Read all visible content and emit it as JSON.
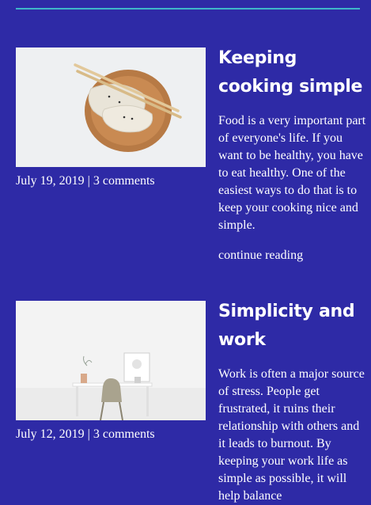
{
  "posts": [
    {
      "title": "Keeping cooking simple",
      "date": "July 19, 2019",
      "separator": "|",
      "comments": "3 comments",
      "excerpt": "Food is a very important part of everyone's life. If you want to be healthy, you have to eat healthy. One of the easiest ways to do that is to keep your cooking nice and simple.",
      "more": "continue reading",
      "image_icon": "dumplings-photo"
    },
    {
      "title": "Simplicity and work",
      "date": "July 12, 2019",
      "separator": "|",
      "comments": "3 comments",
      "excerpt": "Work is often a major source of stress. People get frustrated, it ruins their relationship with others and it leads to burnout. By keeping your work life as simple as possible, it will help balance",
      "image_icon": "desk-photo"
    }
  ],
  "colors": {
    "background": "#2e2aa6",
    "rule": "#3fb6c9",
    "text": "#ffffff"
  }
}
